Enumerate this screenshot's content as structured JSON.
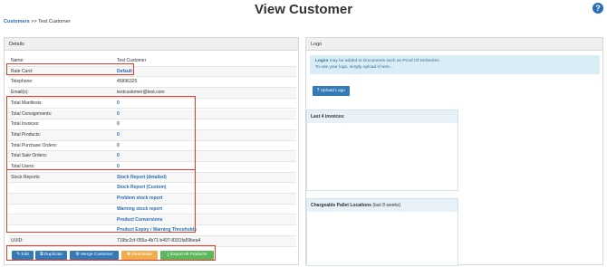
{
  "page": {
    "title": "View Customer",
    "help_symbol": "?"
  },
  "breadcrumb": {
    "parent": "Customers",
    "separator": ">>",
    "current": "Test Customer"
  },
  "details": {
    "heading": "Details",
    "name": {
      "label": "Name:",
      "value": "Test Customer"
    },
    "rate_card": {
      "label": "Rate Card:",
      "value": "Default"
    },
    "telephone": {
      "label": "Telephone:",
      "value": "45896325"
    },
    "emails": {
      "label": "Email(s):",
      "value": "testcustomer@test.com"
    },
    "totals": [
      {
        "label": "Total Manifests:",
        "value": "0"
      },
      {
        "label": "Total Consignments:",
        "value": "0"
      },
      {
        "label": "Total Invoices:",
        "value": "0"
      },
      {
        "label": "Total Products:",
        "value": "0"
      },
      {
        "label": "Total Purchase Orders:",
        "value": "0"
      },
      {
        "label": "Total Sale Orders:",
        "value": "0"
      },
      {
        "label": "Total Users:",
        "value": "0"
      }
    ],
    "stock_reports": {
      "label": "Stock Reports:",
      "links": [
        "Stock Report (detailed)",
        "Stock Report (Custom)",
        "Problem stock report",
        "Warning stock report",
        "Product Conversions",
        "Product Expiry / Warning Thresholds"
      ]
    },
    "uuid": {
      "label": "UUID:",
      "value": "719bc2cf-055a-4b71-b497-8331fa59bea4"
    }
  },
  "actions": {
    "edit": "Edit",
    "duplicate": "Duplicate",
    "merge": "Merge Customer",
    "deactivate": "Deactivate",
    "export": "Export All Products"
  },
  "logo": {
    "heading": "Logo",
    "info_bold": "Logos",
    "info_text": "may be added to Documents such as Proof Of Deliveries.",
    "info_line2": "To use your logo, simply upload it here...",
    "upload": "Upload Logo"
  },
  "last_invoices": {
    "heading": "Last 4 invoices:"
  },
  "pallet_locations": {
    "heading": "Chargeable Pallet Locations",
    "note": "(last 8 weeks)"
  },
  "colors": {
    "accent": "#2a6db5",
    "highlight": "#e23a2b",
    "warning": "#f0ad4e",
    "success": "#5cb85c"
  }
}
